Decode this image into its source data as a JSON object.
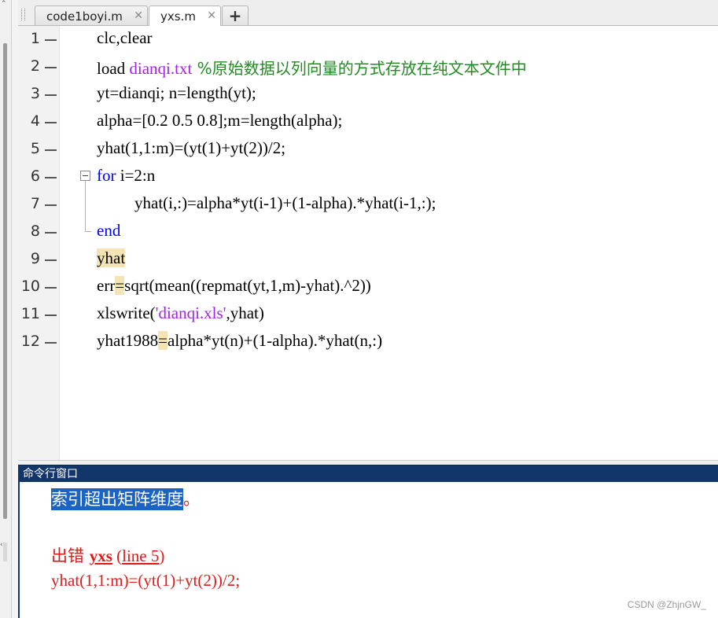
{
  "tabs": [
    {
      "label": "code1boyi.m",
      "active": false
    },
    {
      "label": "yxs.m",
      "active": true
    }
  ],
  "add_tab_label": "+",
  "editor": {
    "lines": [
      {
        "num": "1",
        "tokens": [
          {
            "t": "clc,clear",
            "c": "plain"
          }
        ],
        "indent": 0
      },
      {
        "num": "2",
        "tokens": [
          {
            "t": "load ",
            "c": "plain"
          },
          {
            "t": "dianqi.txt",
            "c": "str"
          },
          {
            "t": " %原始数据以列向量的方式存放在纯文本文件中",
            "c": "cmt"
          }
        ],
        "indent": 0
      },
      {
        "num": "3",
        "tokens": [
          {
            "t": "yt=dianqi; n=length(yt);",
            "c": "plain"
          }
        ],
        "indent": 0
      },
      {
        "num": "4",
        "tokens": [
          {
            "t": "alpha=[0.2 0.5 0.8];m=length(alpha);",
            "c": "plain"
          }
        ],
        "indent": 0
      },
      {
        "num": "5",
        "tokens": [
          {
            "t": "yhat(1,1:m)=(yt(1)+yt(2))/2;",
            "c": "plain"
          }
        ],
        "indent": 0
      },
      {
        "num": "6",
        "tokens": [
          {
            "t": "for",
            "c": "kw"
          },
          {
            "t": " i=2:n",
            "c": "plain"
          }
        ],
        "indent": 0
      },
      {
        "num": "7",
        "tokens": [
          {
            "t": "yhat(i,:)=alpha*yt(i-1)+(1-alpha).*yhat(i-1,:);",
            "c": "plain"
          }
        ],
        "indent": 1
      },
      {
        "num": "8",
        "tokens": [
          {
            "t": "end",
            "c": "kw"
          }
        ],
        "indent": 0
      },
      {
        "num": "9",
        "tokens": [
          {
            "t": "yhat",
            "c": "hl"
          }
        ],
        "indent": 0
      },
      {
        "num": "10",
        "tokens": [
          {
            "t": "err",
            "c": "plain"
          },
          {
            "t": "=",
            "c": "hl"
          },
          {
            "t": "sqrt(mean((repmat(yt,1,m)-yhat).^2))",
            "c": "plain"
          }
        ],
        "indent": 0
      },
      {
        "num": "11",
        "tokens": [
          {
            "t": "xlswrite(",
            "c": "plain"
          },
          {
            "t": "'dianqi.xls'",
            "c": "str"
          },
          {
            "t": ",yhat)",
            "c": "plain"
          }
        ],
        "indent": 0
      },
      {
        "num": "12",
        "tokens": [
          {
            "t": "yhat1988",
            "c": "plain"
          },
          {
            "t": "=",
            "c": "hl"
          },
          {
            "t": "alpha*yt(n)+(1-alpha).*yhat(n,:)",
            "c": "plain"
          }
        ],
        "indent": 0
      }
    ]
  },
  "command_window": {
    "title": "命令行窗口",
    "error_message": "索引超出矩阵维度",
    "error_message_tail": "。",
    "error_prefix": "出错 ",
    "error_function": "yxs",
    "error_location_open": " (",
    "error_location": "line 5",
    "error_location_close": ")",
    "error_code": "yhat(1,1:m)=(yt(1)+yt(2))/2;"
  },
  "watermark": "CSDN @ZhjnGW_",
  "colors": {
    "keyword": "#0000ff",
    "string": "#a020f0",
    "comment": "#228b22",
    "error": "#e01818",
    "highlight": "#f4e3b5",
    "cmd_titlebar": "#13366a"
  }
}
